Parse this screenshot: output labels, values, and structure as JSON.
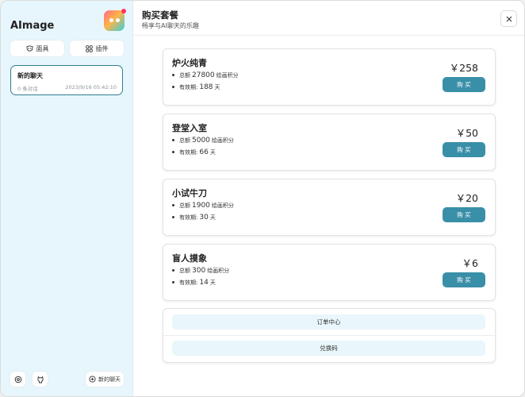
{
  "sidebar": {
    "app_title": "AImage",
    "mask_label": "面具",
    "plugin_label": "插件",
    "chats": [
      {
        "title": "新的聊天",
        "count": "0 条对话",
        "date": "2023/9/16 05:42:10"
      }
    ],
    "new_chat_label": "新的聊天"
  },
  "header": {
    "title": "购买套餐",
    "subtitle": "畅享与AI聊天的乐趣"
  },
  "plans": [
    {
      "name": "炉火纯青",
      "credit_prefix": "总额",
      "credits": "27800",
      "credit_unit": "绘画积分",
      "validity_label": "有效期:",
      "validity": "188",
      "validity_unit": "天",
      "price": "￥258",
      "buy_label": "购 买"
    },
    {
      "name": "登堂入室",
      "credit_prefix": "总额",
      "credits": "5000",
      "credit_unit": "绘画积分",
      "validity_label": "有效期:",
      "validity": "66",
      "validity_unit": "天",
      "price": "￥50",
      "buy_label": "购 买"
    },
    {
      "name": "小试牛刀",
      "credit_prefix": "总额",
      "credits": "1900",
      "credit_unit": "绘画积分",
      "validity_label": "有效期:",
      "validity": "30",
      "validity_unit": "天",
      "price": "￥20",
      "buy_label": "购 买"
    },
    {
      "name": "盲人摸象",
      "credit_prefix": "总额",
      "credits": "300",
      "credit_unit": "绘画积分",
      "validity_label": "有效期:",
      "validity": "14",
      "validity_unit": "天",
      "price": "￥6",
      "buy_label": "购 买"
    }
  ],
  "links": {
    "orders_label": "订单中心",
    "redeem_label": "兑换码"
  },
  "colors": {
    "sidebar_bg": "#e7f6fd",
    "accent": "#3a8fa8",
    "selected_border": "#2f7f93",
    "link_bg": "#e9f6fc"
  }
}
